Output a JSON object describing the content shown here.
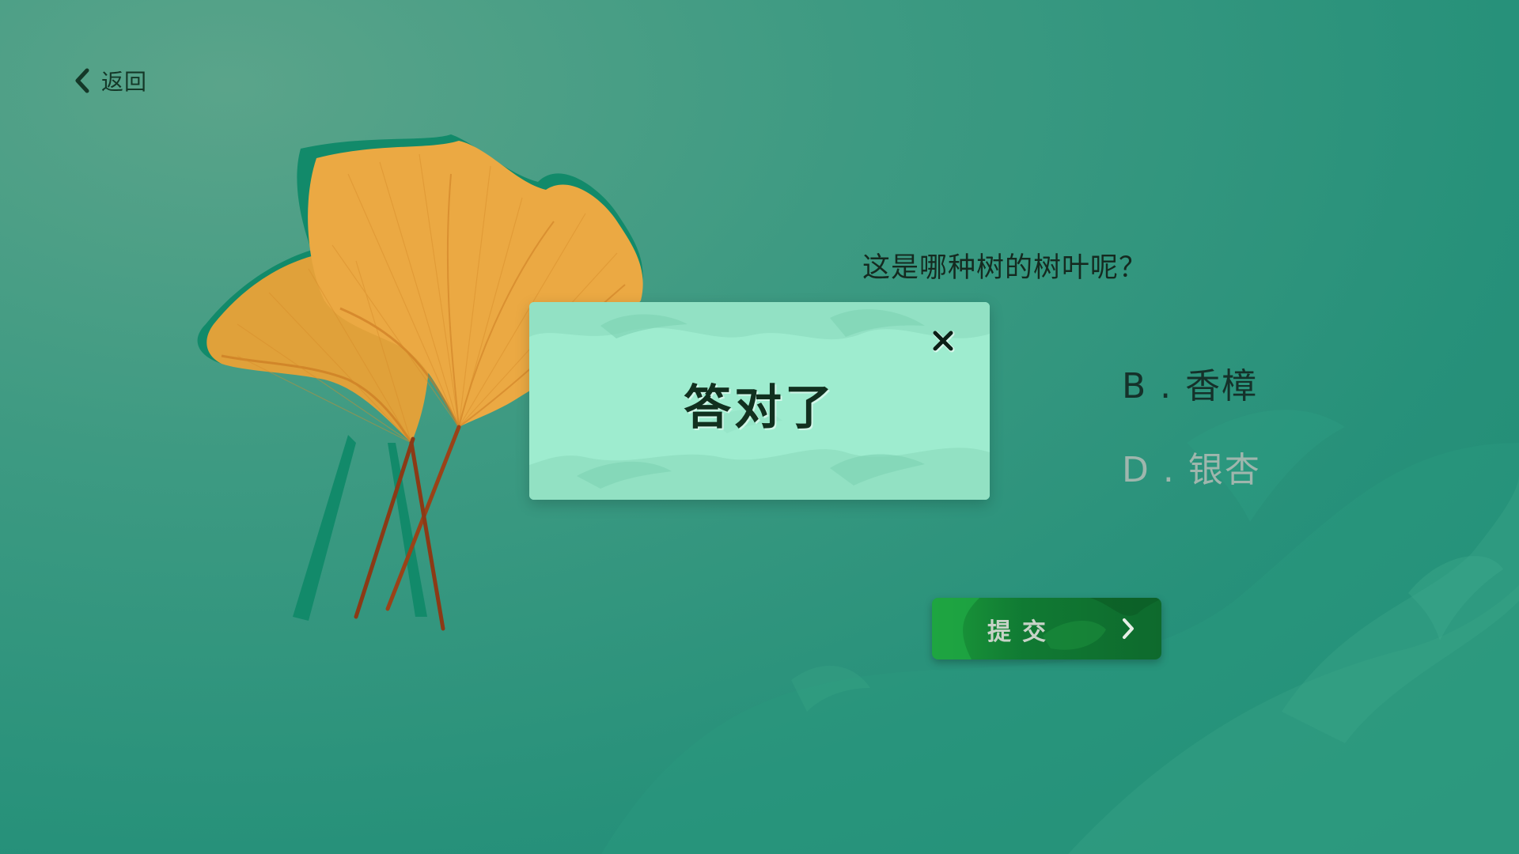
{
  "colors": {
    "background": "#2e9479",
    "modal_bg": "#9eeccf",
    "submit_green": "#107a33",
    "text_dark": "#152a20",
    "option_disabled": "#9fb6ad"
  },
  "nav": {
    "back_label": "返回",
    "back_icon": "chevron-left-icon"
  },
  "quiz": {
    "question": "这是哪种树的树叶呢？",
    "options": [
      {
        "text": "B . 香樟"
      },
      {
        "text": "D . 银杏"
      }
    ],
    "submit_label": "提交",
    "submit_icon": "chevron-right-icon"
  },
  "modal": {
    "title": "答对了",
    "close_icon": "close-icon"
  }
}
